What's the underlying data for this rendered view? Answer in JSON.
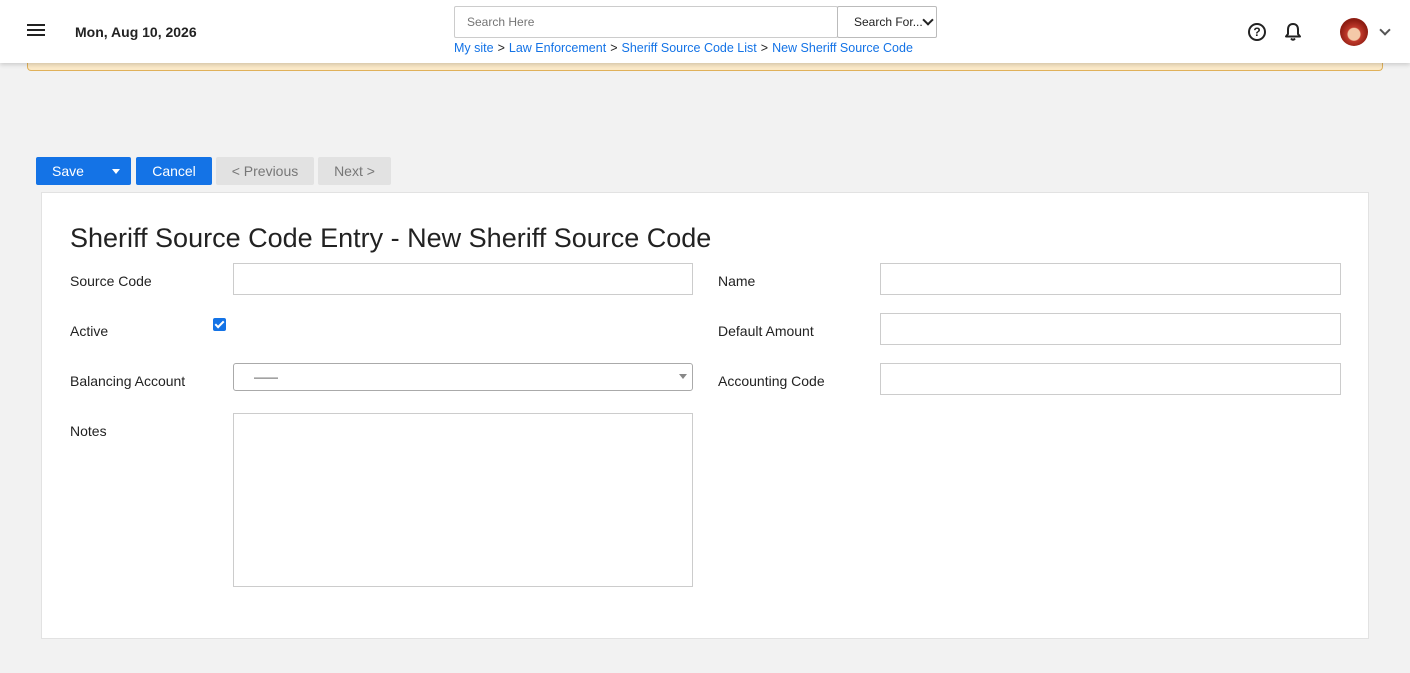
{
  "header": {
    "date": "Mon, Aug 10, 2026",
    "search": {
      "placeholder": "Search Here",
      "value": ""
    },
    "search_for": "Search For...",
    "breadcrumb": [
      "My site",
      "Law Enforcement",
      "Sheriff Source Code List",
      "New Sheriff Source Code"
    ]
  },
  "toolbar": {
    "save_label": "Save",
    "cancel_label": "Cancel",
    "previous_label": "< Previous",
    "next_label": "Next >"
  },
  "form": {
    "title": "Sheriff Source Code Entry - New Sheriff Source Code",
    "source_code": {
      "label": "Source Code",
      "value": ""
    },
    "name": {
      "label": "Name",
      "value": ""
    },
    "active": {
      "label": "Active",
      "checked": true
    },
    "default_amount": {
      "label": "Default Amount",
      "value": ""
    },
    "balancing_account": {
      "label": "Balancing Account",
      "selected": "——"
    },
    "accounting_code": {
      "label": "Accounting Code",
      "value": ""
    },
    "notes": {
      "label": "Notes",
      "value": ""
    }
  },
  "colors": {
    "accent": "#1473e6",
    "warning_bg": "#fbe9c7",
    "warning_border": "#e0b15a"
  },
  "icons": [
    "menu-icon",
    "help-icon",
    "bell-icon",
    "avatar",
    "chevron-down-icon",
    "caret-down-icon"
  ]
}
